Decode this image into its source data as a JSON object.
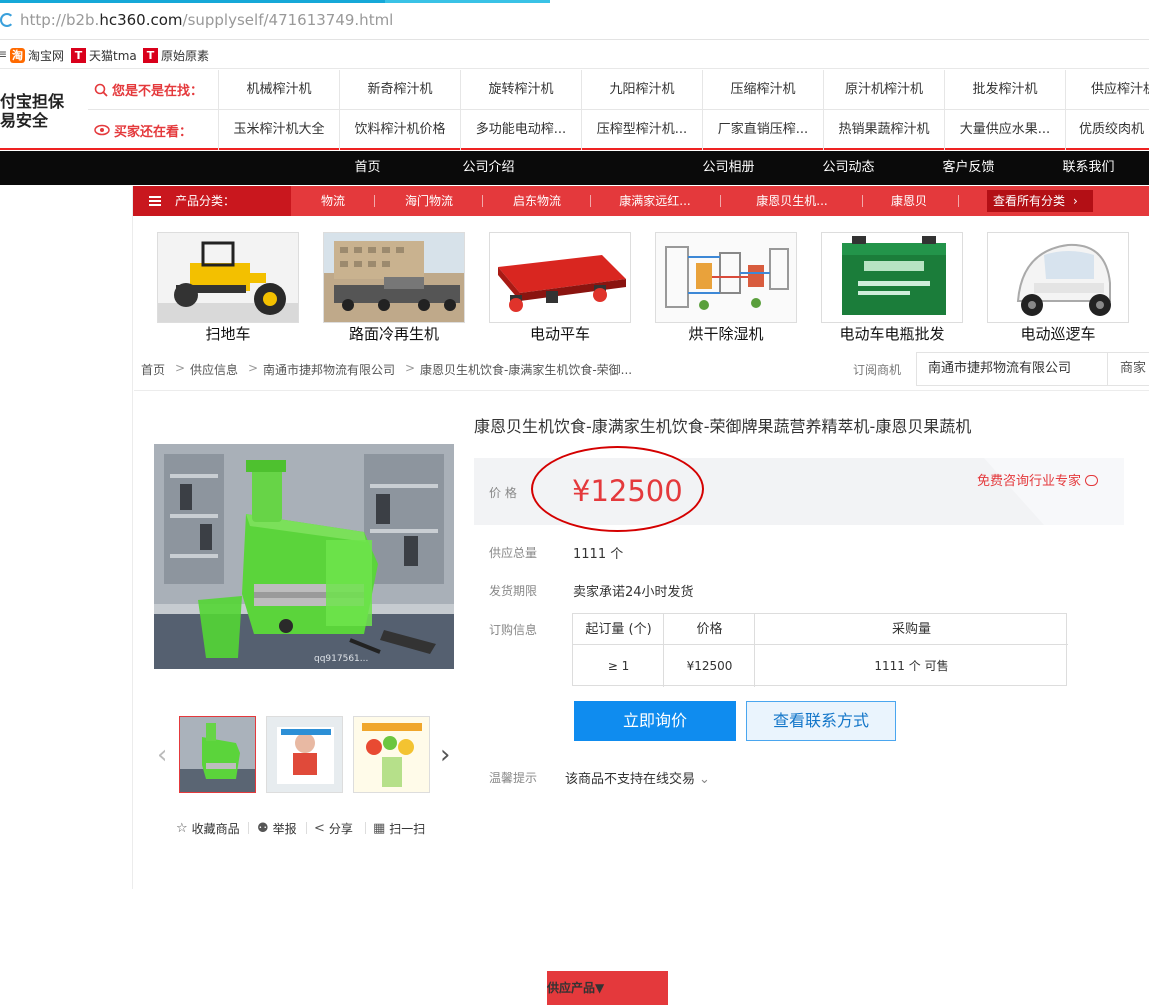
{
  "browser": {
    "url_prefix": "http://b2b.",
    "url_domain": "hc360.com",
    "url_path": "/supplyself/471613749.html",
    "bookmarks": [
      {
        "icon_text": "淘",
        "label": "淘宝网",
        "color": "#ff6a00"
      },
      {
        "icon_text": "T",
        "label": "天猫tma",
        "color": "#d9001b"
      },
      {
        "icon_text": "T",
        "label": "原始原素",
        "color": "#d9001b"
      }
    ],
    "bookmark_cut_prefix": "≡"
  },
  "header": {
    "logo_line1": "付宝担保",
    "logo_line2": "易安全",
    "row1_label": "您是不是在找：",
    "row1_items": [
      "机械榨汁机",
      "新奇榨汁机",
      "旋转榨汁机",
      "九阳榨汁机",
      "压缩榨汁机",
      "原汁机榨汁机",
      "批发榨汁机",
      "供应榨汁机"
    ],
    "row2_label": "买家还在看：",
    "row2_items": [
      "玉米榨汁机大全",
      "饮料榨汁机价格",
      "多功能电动榨...",
      "压榨型榨汁机...",
      "厂家直销压榨...",
      "热销果蔬榨汁机",
      "大量供应水果...",
      "优质绞肉机"
    ]
  },
  "nav": {
    "items": [
      "首页",
      "公司介绍",
      "供应产品▼",
      "公司相册",
      "公司动态",
      "客户反馈",
      "联系我们"
    ],
    "active_index": 2
  },
  "category_bar": {
    "label": "产品分类：",
    "items": [
      "物流",
      "海门物流",
      "启东物流",
      "康满家远红...",
      "康恩贝生机...",
      "康恩贝"
    ],
    "view_all": "查看所有分类"
  },
  "featured_products": [
    {
      "caption": "扫地车",
      "image": "yellow-road-roller"
    },
    {
      "caption": "路面冷再生机",
      "image": "road-recycler-truck"
    },
    {
      "caption": "电动平车",
      "image": "red-flat-cart"
    },
    {
      "caption": "烘干除湿机",
      "image": "dryer-diagram"
    },
    {
      "caption": "电动车电瓶批发",
      "image": "green-battery"
    },
    {
      "caption": "电动巡逻车",
      "image": "white-patrol-scooter"
    }
  ],
  "breadcrumb": {
    "items": [
      "首页",
      "供应信息",
      "南通市捷邦物流有限公司",
      "康恩贝生机饮食-康满家生机饮食-荣御..."
    ],
    "separator": ">",
    "subscribe": "订阅商机",
    "company": "南通市捷邦物流有限公司",
    "merchant_cut": "商家"
  },
  "product": {
    "title": "康恩贝生机饮食-康满家生机饮食-荣御牌果蔬营养精萃机-康恩贝果蔬机",
    "price_label": "价 格",
    "price": "¥12500",
    "consult": "免费咨询行业专家",
    "supply_label": "供应总量",
    "supply_value": "1111 个",
    "ship_label": "发货期限",
    "ship_value": "卖家承诺24小时发货",
    "order_label": "订购信息",
    "order_table": {
      "headers": [
        "起订量 (个)",
        "价格",
        "采购量"
      ],
      "row": [
        "≥ 1",
        "¥12500",
        "1111 个 可售"
      ]
    },
    "inquire_button": "立即询价",
    "contact_button": "查看联系方式",
    "tip_label": "温馨提示",
    "tip_value": "该商品不支持在线交易",
    "watermark": "qq917561..."
  },
  "actions": [
    "收藏商品",
    "举报",
    "分享",
    "扫一扫"
  ],
  "colors": {
    "brand_red": "#e4393c",
    "nav_black": "#0a0a0a",
    "inquire_blue": "#0f8cef",
    "annotation_oval": "#d40000"
  }
}
